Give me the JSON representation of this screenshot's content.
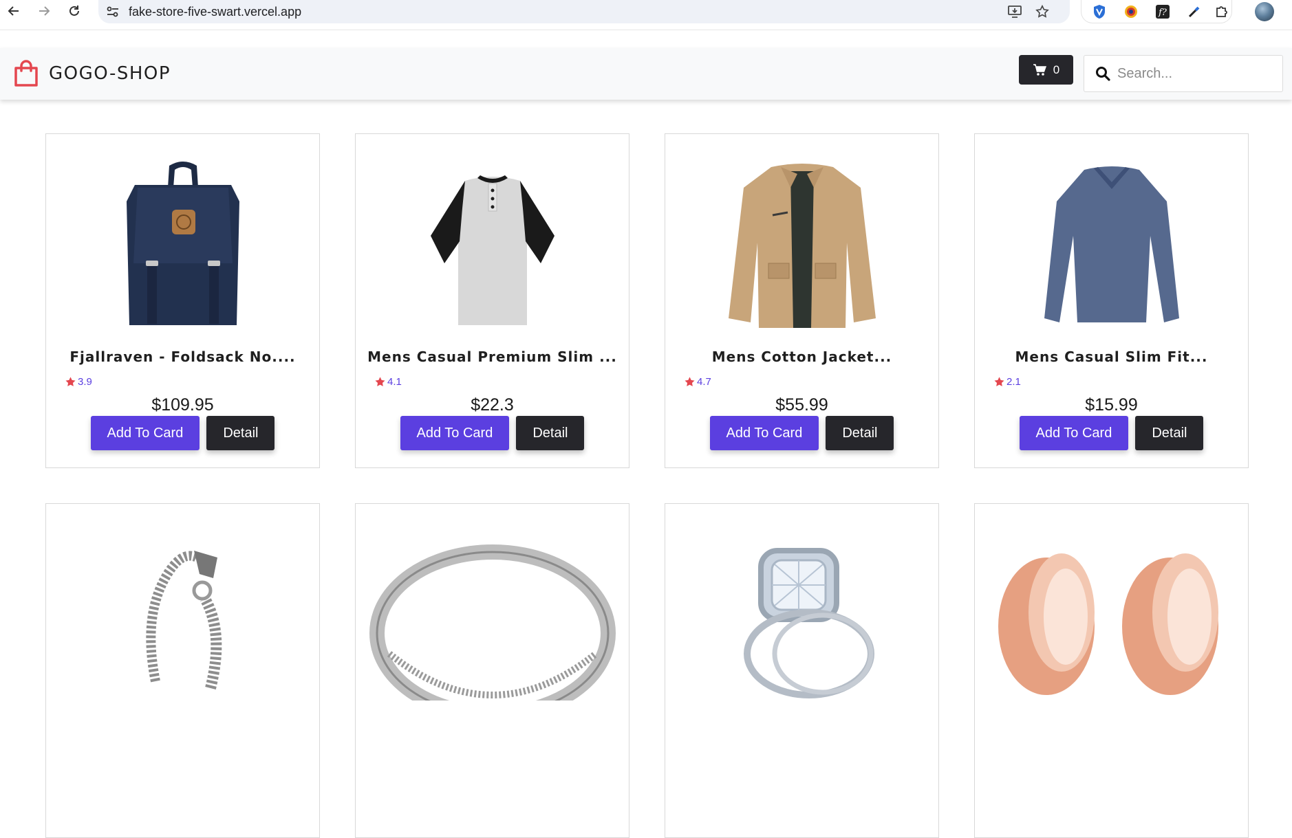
{
  "browser": {
    "url": "fake-store-five-swart.vercel.app",
    "extensions": [
      "shield-extension-icon",
      "colorful-extension-icon",
      "fx-extension-icon",
      "eyedropper-extension-icon",
      "puzzle-extensions-icon"
    ]
  },
  "header": {
    "brand": "GOGO-SHOP",
    "cart_count": "0",
    "search_placeholder": "Search..."
  },
  "colors": {
    "accent": "#5b3fe0",
    "dark": "#26262b",
    "brand_icon": "#e4474f",
    "star": "#e4474f"
  },
  "products": [
    {
      "title": "Fjallraven - Foldsack No....",
      "rating": "3.9",
      "price": "$109.95",
      "add_label": "Add To Card",
      "detail_label": "Detail",
      "image": "backpack-image"
    },
    {
      "title": "Mens Casual Premium Slim ...",
      "rating": "4.1",
      "price": "$22.3",
      "add_label": "Add To Card",
      "detail_label": "Detail",
      "image": "raglan-tshirt-image"
    },
    {
      "title": "Mens Cotton Jacket...",
      "rating": "4.7",
      "price": "$55.99",
      "add_label": "Add To Card",
      "detail_label": "Detail",
      "image": "cotton-jacket-image"
    },
    {
      "title": "Mens Casual Slim Fit...",
      "rating": "2.1",
      "price": "$15.99",
      "add_label": "Add To Card",
      "detail_label": "Detail",
      "image": "longsleeve-shirt-image"
    },
    {
      "title": "",
      "rating": "",
      "price": "",
      "add_label": "",
      "detail_label": "",
      "image": "dragon-bracelet-image"
    },
    {
      "title": "",
      "rating": "",
      "price": "",
      "add_label": "",
      "detail_label": "",
      "image": "silver-ring-image"
    },
    {
      "title": "",
      "rating": "",
      "price": "",
      "add_label": "",
      "detail_label": "",
      "image": "diamond-ring-image"
    },
    {
      "title": "",
      "rating": "",
      "price": "",
      "add_label": "",
      "detail_label": "",
      "image": "rose-gold-plugs-image"
    }
  ]
}
